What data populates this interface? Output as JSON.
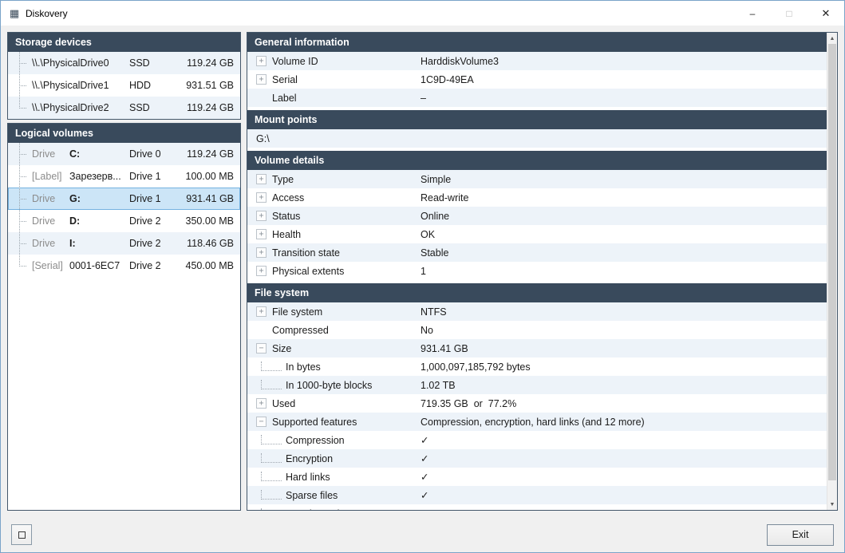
{
  "window": {
    "title": "Diskovery",
    "minimize_glyph": "–",
    "maximize_glyph": "□",
    "close_glyph": "✕"
  },
  "icons": {
    "app": "▦",
    "scroll_up": "▲",
    "scroll_down": "▼"
  },
  "colors": {
    "header_bg": "#394a5c",
    "row_alt_bg": "#edf3f9",
    "selected_bg": "#cce5f7",
    "selected_border": "#74b2e0"
  },
  "storage_devices": {
    "title": "Storage devices",
    "rows": [
      {
        "name": "\\\\.\\PhysicalDrive0",
        "type": "SSD",
        "size": "119.24 GB"
      },
      {
        "name": "\\\\.\\PhysicalDrive1",
        "type": "HDD",
        "size": "931.51 GB"
      },
      {
        "name": "\\\\.\\PhysicalDrive2",
        "type": "SSD",
        "size": "119.24 GB"
      }
    ]
  },
  "logical_volumes": {
    "title": "Logical volumes",
    "rows": [
      {
        "kind": "Drive",
        "id": "C:",
        "device": "Drive 0",
        "size": "119.24 GB",
        "selected": false
      },
      {
        "kind": "[Label]",
        "id": "Зарезерв...",
        "device": "Drive 1",
        "size": "100.00 MB",
        "selected": false
      },
      {
        "kind": "Drive",
        "id": "G:",
        "device": "Drive 1",
        "size": "931.41 GB",
        "selected": true
      },
      {
        "kind": "Drive",
        "id": "D:",
        "device": "Drive 2",
        "size": "350.00 MB",
        "selected": false
      },
      {
        "kind": "Drive",
        "id": "I:",
        "device": "Drive 2",
        "size": "118.46 GB",
        "selected": false
      },
      {
        "kind": "[Serial]",
        "id": "0001-6EC7",
        "device": "Drive 2",
        "size": "450.00 MB",
        "selected": false
      }
    ]
  },
  "details": {
    "sections": [
      {
        "title": "General information",
        "rows": [
          {
            "expand": "+",
            "label": "Volume ID",
            "value": "HarddiskVolume3",
            "indent": 0
          },
          {
            "expand": "+",
            "label": "Serial",
            "value": "1C9D-49EA",
            "indent": 0
          },
          {
            "expand": "",
            "label": "Label",
            "value": "–",
            "indent": 0
          }
        ]
      },
      {
        "title": "Mount points",
        "rows": [
          {
            "expand": "",
            "label": "G:\\",
            "value": "",
            "indent": 0,
            "flush": true
          }
        ]
      },
      {
        "title": "Volume details",
        "rows": [
          {
            "expand": "+",
            "label": "Type",
            "value": "Simple",
            "indent": 0
          },
          {
            "expand": "+",
            "label": "Access",
            "value": "Read-write",
            "indent": 0
          },
          {
            "expand": "+",
            "label": "Status",
            "value": "Online",
            "indent": 0
          },
          {
            "expand": "+",
            "label": "Health",
            "value": "OK",
            "indent": 0
          },
          {
            "expand": "+",
            "label": "Transition state",
            "value": "Stable",
            "indent": 0
          },
          {
            "expand": "+",
            "label": "Physical extents",
            "value": "1",
            "indent": 0
          }
        ]
      },
      {
        "title": "File system",
        "rows": [
          {
            "expand": "+",
            "label": "File system",
            "value": "NTFS",
            "indent": 0
          },
          {
            "expand": "",
            "label": "Compressed",
            "value": "No",
            "indent": 0
          },
          {
            "expand": "−",
            "label": "Size",
            "value": "931.41 GB",
            "indent": 0
          },
          {
            "expand": "",
            "label": "In bytes",
            "value": "1,000,097,185,792 bytes",
            "indent": 1
          },
          {
            "expand": "",
            "label": "In 1000-byte blocks",
            "value": "1.02 TB",
            "indent": 1
          },
          {
            "expand": "+",
            "label": "Used",
            "value": "719.35 GB  or  77.2%",
            "indent": 0
          },
          {
            "expand": "−",
            "label": "Supported features",
            "value": "Compression, encryption, hard links (and 12 more)",
            "indent": 0
          },
          {
            "expand": "",
            "label": "Compression",
            "value": "✓",
            "indent": 1
          },
          {
            "expand": "",
            "label": "Encryption",
            "value": "✓",
            "indent": 1
          },
          {
            "expand": "",
            "label": "Hard links",
            "value": "✓",
            "indent": 1
          },
          {
            "expand": "",
            "label": "Sparse files",
            "value": "✓",
            "indent": 1
          },
          {
            "expand": "",
            "label": "USN journal",
            "value": "✓",
            "indent": 1
          }
        ]
      }
    ]
  },
  "footer": {
    "exit_label": "Exit"
  }
}
